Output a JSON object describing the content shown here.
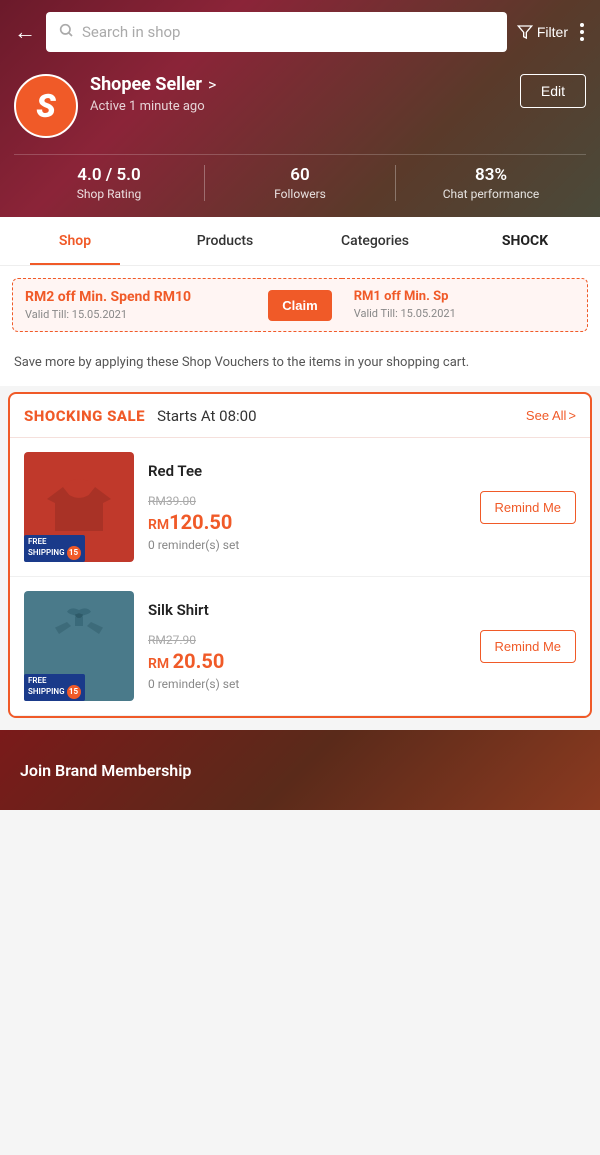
{
  "header": {
    "back_label": "←",
    "search_placeholder": "Search in shop",
    "filter_label": "Filter",
    "more_label": "⋮"
  },
  "shop": {
    "name": "Shopee Seller",
    "name_arrow": ">",
    "active_status": "Active 1 minute ago",
    "edit_label": "Edit",
    "rating_value": "4.0 / 5.0",
    "rating_label": "Shop Rating",
    "followers_value": "60",
    "followers_label": "Followers",
    "chat_value": "83%",
    "chat_label": "Chat performance"
  },
  "tabs": [
    {
      "id": "shop",
      "label": "Shop",
      "active": true,
      "bold": false
    },
    {
      "id": "products",
      "label": "Products",
      "active": false,
      "bold": false
    },
    {
      "id": "categories",
      "label": "Categories",
      "active": false,
      "bold": false
    },
    {
      "id": "shock",
      "label": "SHOCK",
      "active": false,
      "bold": true
    }
  ],
  "vouchers": {
    "hint": "Save more by applying these Shop Vouchers to the items in your shopping cart.",
    "voucher1": {
      "title": "RM2 off Min. Spend RM10",
      "validity": "Valid Till: 15.05.2021"
    },
    "claim_label": "Claim",
    "voucher2": {
      "title": "RM1 off Min. Sp",
      "validity": "Valid Till: 15.05.2021"
    }
  },
  "shocking_sale": {
    "label": "SHOCKING SALE",
    "starts_text": "Starts At 08:00",
    "see_all_label": "See All",
    "chevron": ">",
    "products": [
      {
        "id": "red-tee",
        "name": "Red Tee",
        "original_price": "RM39.00",
        "sale_price": "RM120.50",
        "sale_currency": "RM",
        "sale_amount": "120.50",
        "reminders": "0 reminder(s) set",
        "remind_label": "Remind Me",
        "badge_text": "FREE\nSHIPPING",
        "badge_number": "15",
        "color": "#c0392b"
      },
      {
        "id": "silk-shirt",
        "name": "Silk Shirt",
        "original_price": "RM27.90",
        "sale_price": "RM 20.50",
        "sale_currency": "RM",
        "sale_amount": "20.50",
        "reminders": "0 reminder(s) set",
        "remind_label": "Remind Me",
        "badge_text": "FREE\nSHIPPING",
        "badge_number": "15",
        "color": "#4a7a8a"
      }
    ]
  },
  "brand_membership": {
    "label": "Join Brand Membership"
  }
}
